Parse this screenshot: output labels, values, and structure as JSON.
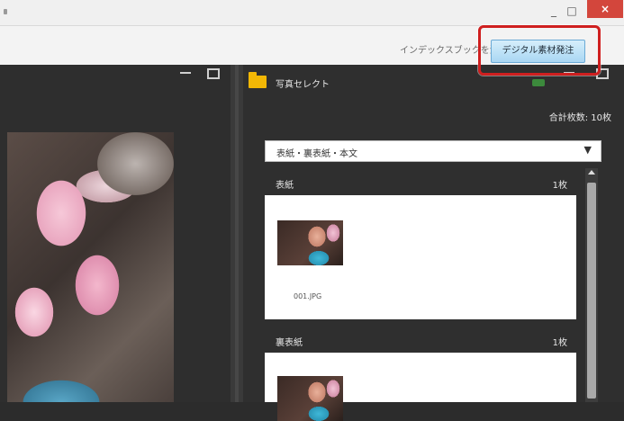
{
  "window": {
    "minimize_label": "_",
    "maximize_label": "□",
    "close_label": "×"
  },
  "toolbar": {
    "index_link": "インデックスブックを注",
    "digital_button": "デジタル素材発注",
    "highlight_color": "#cf1f1f"
  },
  "left_panel": {
    "minimize_icon": "minimize-icon",
    "maximize_icon": "maximize-icon"
  },
  "right_panel": {
    "title": "写真セレクト",
    "total_count": "合計枚数: 10枚",
    "select_value": "表紙・裏表紙・本文",
    "select_arrow": "▼",
    "sections": [
      {
        "label": "表紙",
        "count": "1枚",
        "files": [
          "001.JPG"
        ]
      },
      {
        "label": "裏表紙",
        "count": "1枚",
        "files": [
          ""
        ]
      }
    ]
  },
  "colors": {
    "accent": "#f2b705",
    "button_bg": "#a9d7f3",
    "panel_bg": "#2f2f2f"
  }
}
